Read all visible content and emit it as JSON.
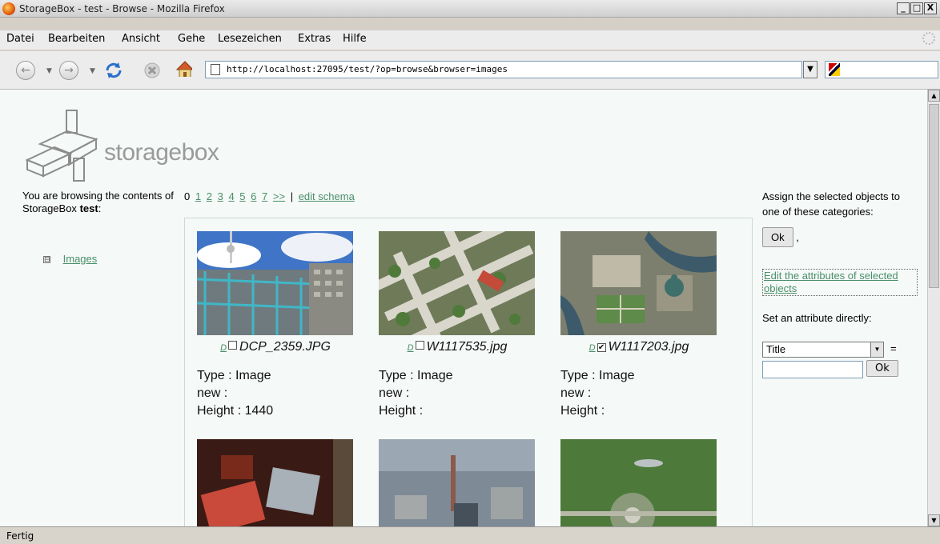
{
  "window": {
    "title": "StorageBox - test - Browse - Mozilla Firefox",
    "controls": [
      "_",
      "□",
      "X"
    ]
  },
  "menu": [
    "Datei",
    "Bearbeiten",
    "Ansicht",
    "Gehe",
    "Lesezeichen",
    "Extras",
    "Hilfe"
  ],
  "nav": {
    "url": "http://localhost:27095/test/?op=browse&browser=images"
  },
  "logo": {
    "text": "storagebox"
  },
  "left": {
    "intro": "You are browsing the contents of StorageBox",
    "box_name": "test",
    "tree": [
      {
        "label": "Images",
        "toggle": "⊟"
      }
    ]
  },
  "pager": {
    "current": "0",
    "pages": [
      "1",
      "2",
      "3",
      "4",
      "5",
      "6",
      "7"
    ],
    "next": ">>",
    "separator": "|",
    "edit_schema": "edit schema"
  },
  "items": [
    {
      "d": "D",
      "checked": false,
      "name": "DCP_2359.JPG",
      "type": "Type : Image",
      "new": "new :",
      "height": "Height : 1440"
    },
    {
      "d": "D",
      "checked": false,
      "name": "W1117535.jpg",
      "type": "Type : Image",
      "new": "new :",
      "height": "Height :"
    },
    {
      "d": "D",
      "checked": true,
      "name": "W1117203.jpg",
      "type": "Type : Image",
      "new": "new :",
      "height": "Height :"
    }
  ],
  "right": {
    "assign_text": "Assign the selected objects to one of these categories:",
    "ok_label": "Ok",
    "comma": ",",
    "edit_attrs": "Edit the attributes of selected objects",
    "set_attr": "Set an attribute directly:",
    "attr_select": "Title",
    "equals": "=",
    "ok2_label": "Ok"
  },
  "status": "Fertig"
}
